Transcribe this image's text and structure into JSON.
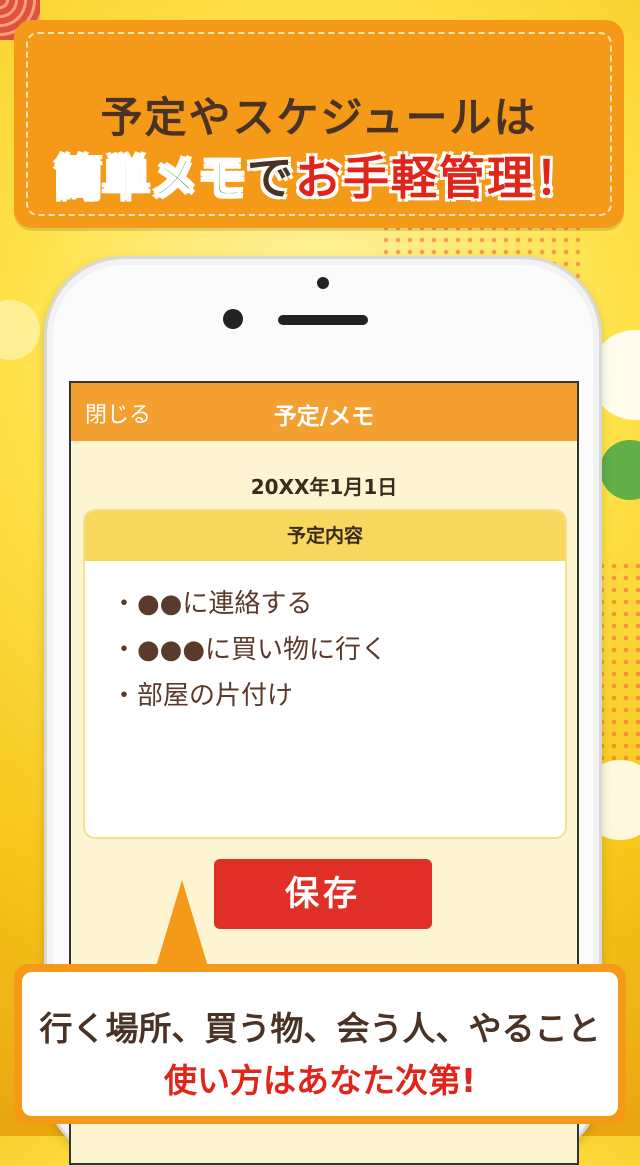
{
  "headline": {
    "line1": "予定やスケジュールは",
    "line2_green": "簡単メモ",
    "line2_dark": "で",
    "line2_red": "お手軽管理！"
  },
  "navbar": {
    "close_label": "閉じる",
    "title": "予定/メモ"
  },
  "memo": {
    "date": "20XX年1月1日",
    "section_title": "予定内容",
    "items": [
      "・●●に連絡する",
      "・●●●に買い物に行く",
      "・部屋の片付け"
    ]
  },
  "save_label": "保存",
  "caption": {
    "line1": "行く場所、買う物、会う人、やること",
    "line2": "使い方はあなた次第!"
  },
  "colors": {
    "accent_orange": "#f59a18",
    "nav_orange": "#f4a030",
    "save_red": "#e02f26",
    "green": "#2e9f3e"
  }
}
